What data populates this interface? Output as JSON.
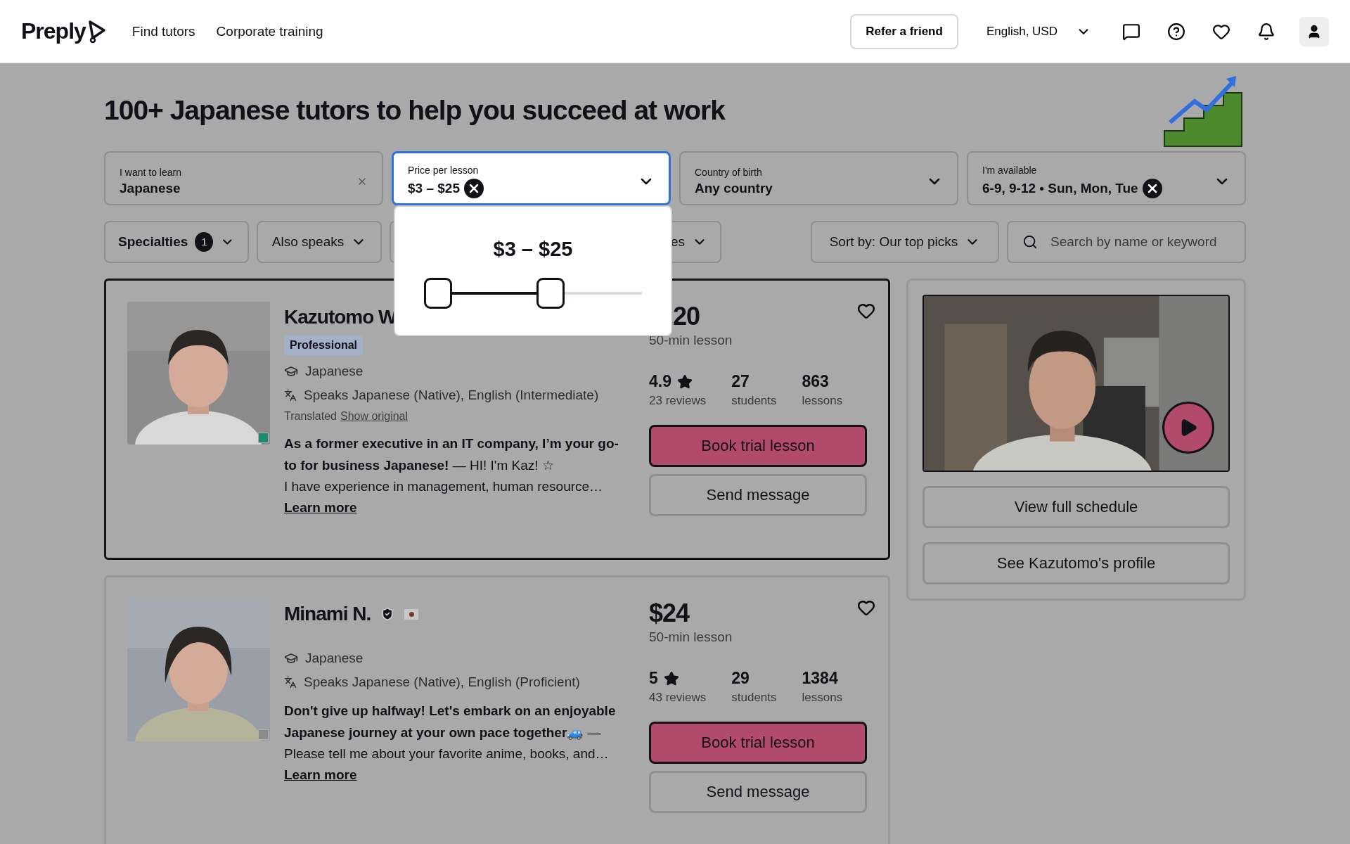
{
  "header": {
    "logo": "Preply",
    "nav": [
      "Find tutors",
      "Corporate training"
    ],
    "refer_button": "Refer a friend",
    "locale": "English, USD"
  },
  "title": "100+ Japanese tutors to help you succeed at work",
  "filters": [
    {
      "kind": "input",
      "label": "I want to learn",
      "value": "Japanese",
      "open": false
    },
    {
      "kind": "dropdown",
      "label": "Price per lesson",
      "value": "$3 – $25",
      "clearable": true,
      "open": true
    },
    {
      "kind": "dropdown",
      "label": "Country of birth",
      "value": "Any country",
      "clearable": false,
      "open": false
    },
    {
      "kind": "dropdown",
      "label": "I'm available",
      "value": "6-9, 9-12 • Sun, Mon, Tue",
      "clearable": true,
      "open": false
    }
  ],
  "pills": [
    {
      "label": "Specialties",
      "count": "1"
    },
    {
      "label": "Also speaks"
    },
    {
      "label": "es"
    }
  ],
  "sort": "Sort by: Our top picks",
  "search": {
    "placeholder": "Search by name or keyword"
  },
  "price_popover": {
    "range": "$3 – $25",
    "thumbs": [
      {
        "level": 0
      },
      {
        "level": 0.55
      }
    ]
  },
  "tutors": [
    {
      "name": "Kazutomo W",
      "highlighted": true,
      "online": true,
      "badge": "Professional",
      "subject": "Japanese",
      "speaks": "Speaks Japanese (Native), English (Intermediate)",
      "translated": {
        "label": "Translated",
        "link": "Show original"
      },
      "headline": "**As a former executive in an IT company, I’m your go-to for business Japanese!** — HI! I'm Kaz! ☆",
      "about": "I have experience in management, human resource…",
      "learn_more": "Learn more",
      "price": "20",
      "price_note": "50-min lesson",
      "stats": [
        {
          "kind": "rating",
          "value": "4.9",
          "label": "23 reviews"
        },
        {
          "kind": "count",
          "value": "27",
          "label": "students"
        },
        {
          "kind": "count",
          "value": "863",
          "label": "lessons"
        }
      ],
      "book": "Book trial lesson",
      "message": "Send message"
    },
    {
      "name": "Minami N.",
      "verified": true,
      "flag": true,
      "highlighted": false,
      "online": false,
      "subject": "Japanese",
      "speaks": "Speaks Japanese (Native), English (Proficient)",
      "headline": "**Don't give up halfway! Let's embark on an enjoyable Japanese journey at your own pace together🚙** —",
      "about": "Please tell me about your favorite anime, books, and…",
      "learn_more": "Learn more",
      "price": "$24",
      "price_note": "50-min lesson",
      "stats": [
        {
          "kind": "rating",
          "value": "5",
          "label": "43 reviews"
        },
        {
          "kind": "count",
          "value": "29",
          "label": "students"
        },
        {
          "kind": "count",
          "value": "1384",
          "label": "lessons"
        }
      ],
      "book": "Book trial lesson",
      "message": "Send message"
    }
  ],
  "side_panel": {
    "video": {
      "kind": "picture"
    },
    "buttons": [
      "View full schedule",
      "See Kazutomo's profile"
    ]
  }
}
